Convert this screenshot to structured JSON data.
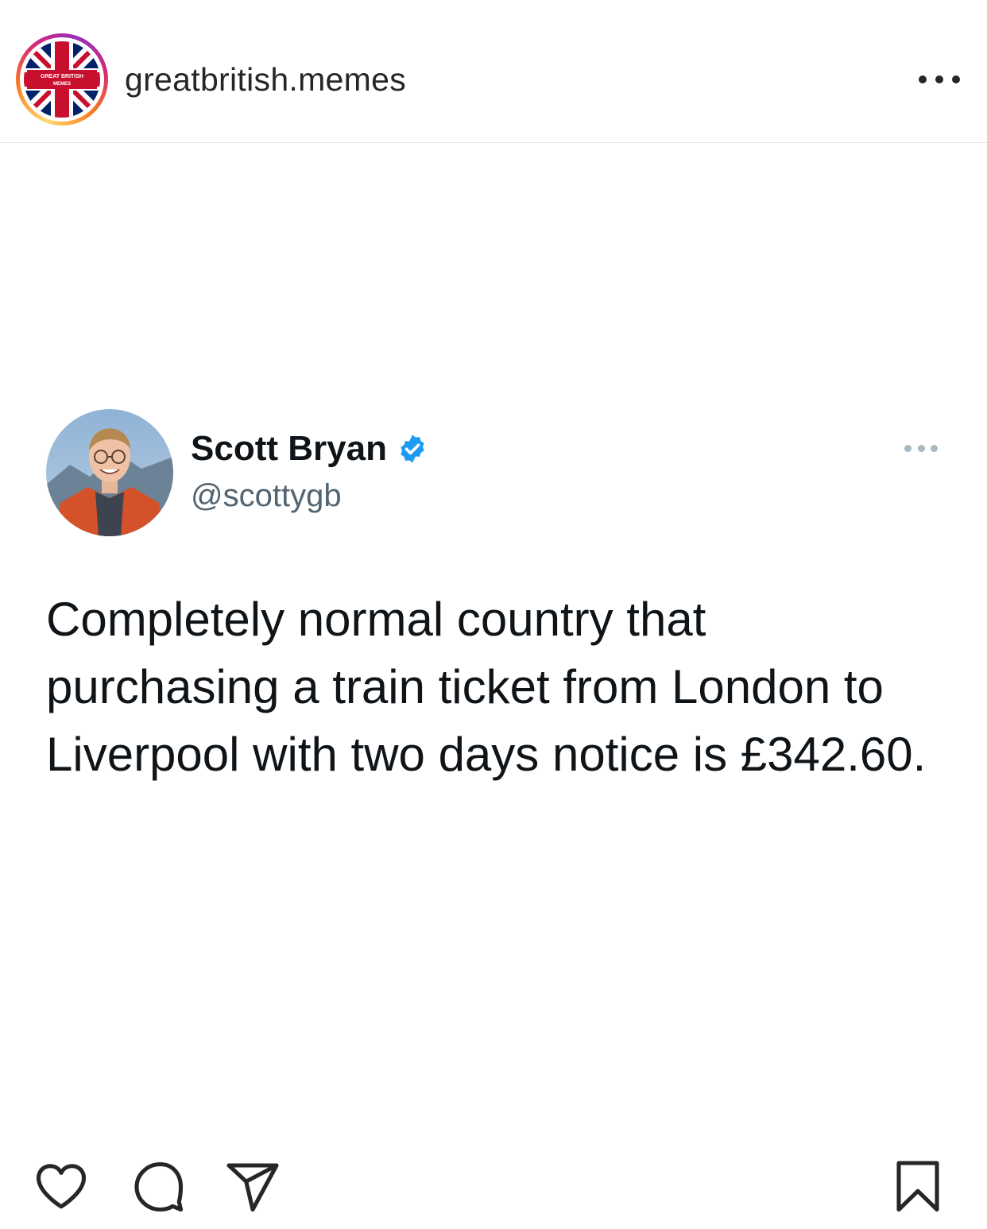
{
  "post": {
    "username": "greatbritish.memes",
    "avatar_text": "GREAT BRITISH MEMES",
    "more_icon": "more-horizontal-icon"
  },
  "tweet": {
    "author_name": "Scott Bryan",
    "verified": true,
    "handle": "@scottygb",
    "text": "Completely normal country that purchasing a train ticket from London to Liverpool with two days notice is £342.60.",
    "colors": {
      "verified_badge": "#1d9bf0",
      "name": "#0f1419",
      "handle": "#536471"
    }
  },
  "actions": {
    "icons": [
      "heart-icon",
      "comment-icon",
      "share-icon",
      "bookmark-icon"
    ]
  }
}
